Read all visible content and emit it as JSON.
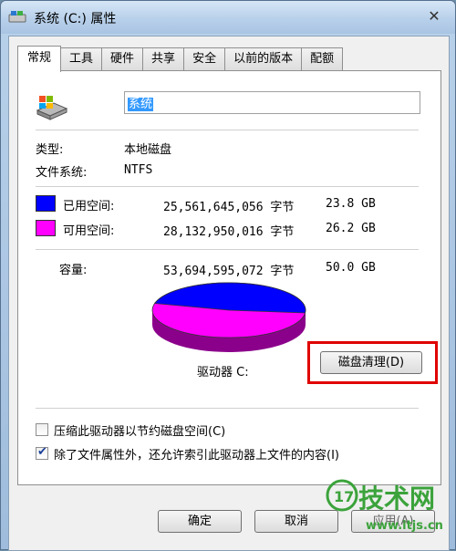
{
  "window": {
    "title": "系统 (C:) 属性",
    "close_glyph": "✕"
  },
  "tabs": [
    "常规",
    "工具",
    "硬件",
    "共享",
    "安全",
    "以前的版本",
    "配额"
  ],
  "general": {
    "drive_name": "系统",
    "type_label": "类型:",
    "type_value": "本地磁盘",
    "fs_label": "文件系统:",
    "fs_value": "NTFS",
    "used_label": "已用空间:",
    "used_bytes": "25,561,645,056 字节",
    "used_gb": "23.8 GB",
    "free_label": "可用空间:",
    "free_bytes": "28,132,950,016 字节",
    "free_gb": "26.2 GB",
    "capacity_label": "容量:",
    "capacity_bytes": "53,694,595,072 字节",
    "capacity_gb": "50.0 GB",
    "drive_label": "驱动器 C:",
    "cleanup_button": "磁盘清理(D)",
    "compress_label": "压缩此驱动器以节约磁盘空间(C)",
    "compress_checked": false,
    "index_label": "除了文件属性外，还允许索引此驱动器上文件的内容(I)",
    "index_checked": true,
    "used_fraction": 0.476,
    "colors": {
      "used": "#0000ff",
      "free": "#ff00ff",
      "used_side": "#00008b",
      "free_side": "#8b008b",
      "highlight": "#e00000"
    }
  },
  "buttons": {
    "ok": "确定",
    "cancel": "取消",
    "apply": "应用(A)"
  },
  "watermark": {
    "logo_text": "技术网",
    "url": "www.itjs.cn"
  }
}
